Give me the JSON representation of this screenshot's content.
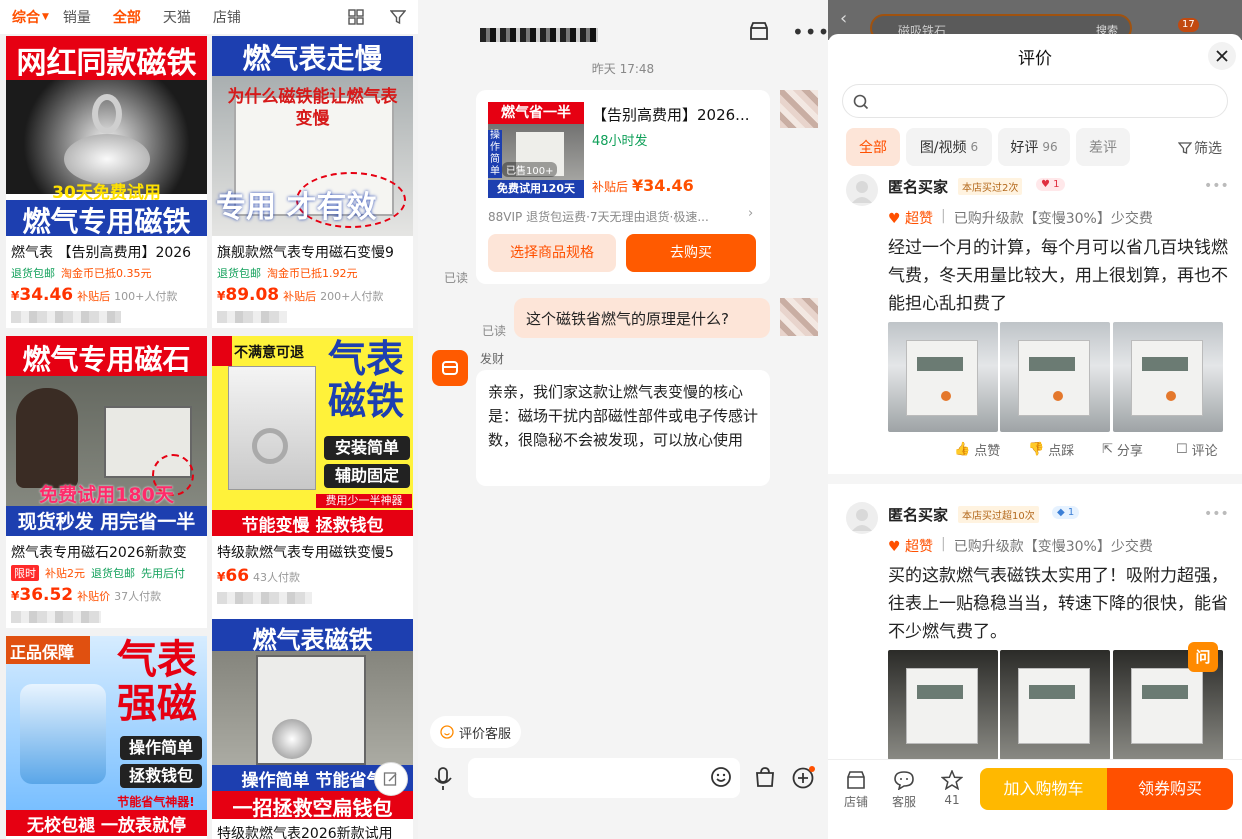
{
  "left": {
    "filters": [
      "综合",
      "销量",
      "全部",
      "天猫",
      "店铺"
    ],
    "active_filter": "全部",
    "products": [
      {
        "banner_top": "网红同款磁铁",
        "banner_mid": "30天免费试用",
        "banner_bottom": "燃气专用磁铁",
        "title": "燃气表 【告别高费用】2026",
        "tag1": "退货包邮",
        "tag2": "淘金币已抵0.35元",
        "currency": "¥",
        "price": "34.46",
        "price_label": "补贴后",
        "sold": "100+人付款"
      },
      {
        "banner_top": "燃气表走慢",
        "banner_mid": "为什么磁铁能让燃气表变慢",
        "banner_bottom": "专用 才有效",
        "title": "旗舰款燃气表专用磁石变慢9",
        "tag1": "退货包邮",
        "tag2": "淘金币已抵1.92元",
        "currency": "¥",
        "price": "89.08",
        "price_label": "补贴后",
        "sold": "200+人付款"
      },
      {
        "banner_top": "燃气专用磁石",
        "banner_mid": "免费试用180天",
        "banner_bottom": "现货秒发 用完省一半",
        "title": "燃气表专用磁石2026新款变",
        "tag_box": "限时",
        "tag0": "补贴2元",
        "tag1": "退货包邮",
        "tag2": "先用后付",
        "currency": "¥",
        "price": "36.52",
        "price_label": "补贴价",
        "sold": "37人付款"
      },
      {
        "banner_top": "不满意可退",
        "banner_big": "气表磁铁",
        "banner_mid1": "安装简单",
        "banner_mid2": "辅助固定",
        "banner_small": "费用少一半神器",
        "banner_bottom": "节能变慢 拯救钱包",
        "title": "特级款燃气表专用磁铁变慢5",
        "currency": "¥",
        "price": "66",
        "sold": "43人付款"
      },
      {
        "banner_top": "正品保障",
        "banner_big": "气表强磁",
        "banner_mid1": "操作简单",
        "banner_mid2": "拯救钱包",
        "banner_small": "节能省气神器!",
        "banner_bottom": "无校包褪 一放表就停"
      },
      {
        "banner_top": "燃气表磁铁",
        "banner_mid": "操作简单 节能省气",
        "banner_bottom": "一招拯救空扁钱包",
        "title": "特级款燃气表2026新款试用"
      }
    ]
  },
  "mid": {
    "timestamp": "昨天 17:48",
    "product_card": {
      "thumb_top": "燃气省一半",
      "thumb_side": "操作简单",
      "thumb_badge": "已售100+",
      "thumb_bottom": "免费试用120天",
      "title": "【告别高费用】2026...",
      "ship": "48小时发",
      "price_label": "补贴后",
      "price": "¥34.46",
      "services": "88VIP 退货包运费·7天无理由退货·极速...",
      "btn_spec": "选择商品规格",
      "btn_buy": "去购买"
    },
    "read1": "已读",
    "read2": "已读",
    "my_message": "这个磁铁省燃气的原理是什么?",
    "agent_name": "发财",
    "agent_message": "亲亲，我们家这款让燃气表变慢的核心是：磁场干扰内部磁性部件或电子传感计数，很隐秘不会被发现，可以放心使用",
    "rate_service": "评价客服"
  },
  "right": {
    "search_hint": "磁吸铁石",
    "search_btn": "搜索",
    "cart_badge": "17",
    "sheet_title": "评价",
    "chips": [
      {
        "label": "全部",
        "count": ""
      },
      {
        "label": "图/视频",
        "count": "6"
      },
      {
        "label": "好评",
        "count": "96"
      },
      {
        "label": "差评",
        "count": ""
      }
    ],
    "filter_label": "筛选",
    "reviews": [
      {
        "user": "匿名买家",
        "badge": "本店买过2次",
        "level": "1",
        "rating": "超赞",
        "variant": "已购升级款【变慢30%】少交费",
        "text": "经过一个月的计算，每个月可以省几百块钱燃气费，冬天用量比较大，用上很划算，再也不能担心乱扣费了",
        "actions": [
          "点赞",
          "点踩",
          "分享",
          "评论"
        ]
      },
      {
        "user": "匿名买家",
        "badge": "本店买过超10次",
        "level": "1",
        "rating": "超赞",
        "variant": "已购升级款【变慢30%】少交费",
        "text": "买的这款燃气表磁铁太实用了！吸附力超强，往表上一贴稳稳当当，转速下降的很快，能省不少燃气费了。"
      }
    ],
    "ask": "问",
    "nav": {
      "shop": "店铺",
      "service": "客服",
      "fav_count": "41",
      "add_cart": "加入购物车",
      "buy": "领券购买"
    }
  },
  "colors": {
    "accent": "#ff5000",
    "subsidy": "#ff3300",
    "green_tag": "#11a05a",
    "buy_gradient_start": "#ffb800"
  }
}
